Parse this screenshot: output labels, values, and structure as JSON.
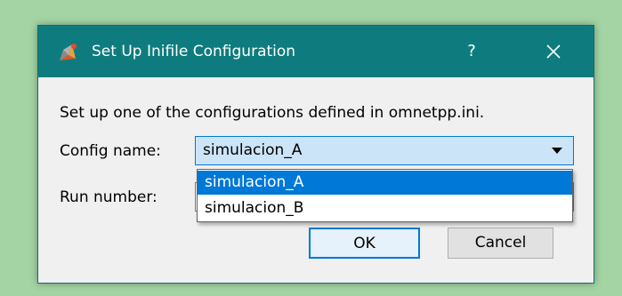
{
  "dialog": {
    "title": "Set Up Inifile Configuration",
    "help_label": "?",
    "description": "Set up one of the configurations defined in omnetpp.ini.",
    "config_label": "Config name:",
    "run_label": "Run number:",
    "config_selected": "simulacion_A",
    "dropdown_options": [
      "simulacion_A",
      "simulacion_B"
    ],
    "ok_label": "OK",
    "cancel_label": "Cancel"
  },
  "colors": {
    "titlebar": "#0e7c7e",
    "selection": "#0078d7",
    "background": "#a4d4a4"
  },
  "icons": {
    "app": "omnetpp-app-icon",
    "close": "close-icon",
    "dropdown": "chevron-down-icon"
  }
}
